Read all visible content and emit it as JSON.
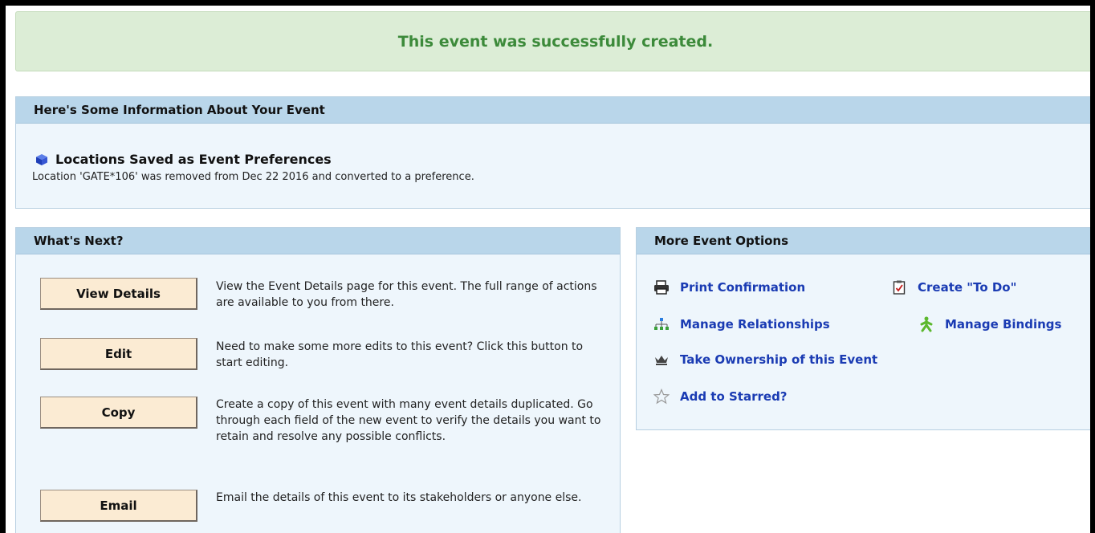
{
  "success_message": "This event was successfully created.",
  "info_panel": {
    "heading": "Here's Some Information About Your Event",
    "title": "Locations Saved as Event Preferences",
    "text": "Location 'GATE*106' was removed from Dec 22 2016 and converted to a preference."
  },
  "whats_next": {
    "heading": "What's Next?",
    "actions": [
      {
        "label": "View Details",
        "description": "View the Event Details page for this event. The full range of actions are available to you from there."
      },
      {
        "label": "Edit",
        "description": "Need to make some more edits to this event? Click this button to start editing."
      },
      {
        "label": "Copy",
        "description": "Create a copy of this event with many event details duplicated. Go through each field of the new event to verify the details you want to retain and resolve any possible conflicts."
      },
      {
        "label": "Email",
        "description": "Email the details of this event to its stakeholders or anyone else."
      }
    ]
  },
  "more_options": {
    "heading": "More Event Options",
    "items": [
      {
        "label": "Print Confirmation",
        "icon": "printer-icon"
      },
      {
        "label": "Create \"To Do\"",
        "icon": "checklist-icon"
      },
      {
        "label": "Manage Relationships",
        "icon": "hierarchy-icon"
      },
      {
        "label": "Manage Bindings",
        "icon": "binding-icon"
      },
      {
        "label": "Take Ownership of this Event",
        "icon": "crown-icon"
      },
      {
        "label": "Add to Starred?",
        "icon": "star-outline-icon"
      }
    ]
  },
  "colors": {
    "success_bg": "#dcedd6",
    "success_text": "#3c8a3a",
    "panel_header": "#b9d6ea",
    "panel_bg": "#eef6fc",
    "link": "#1a3bb3",
    "button_bg": "#fbebd3"
  }
}
